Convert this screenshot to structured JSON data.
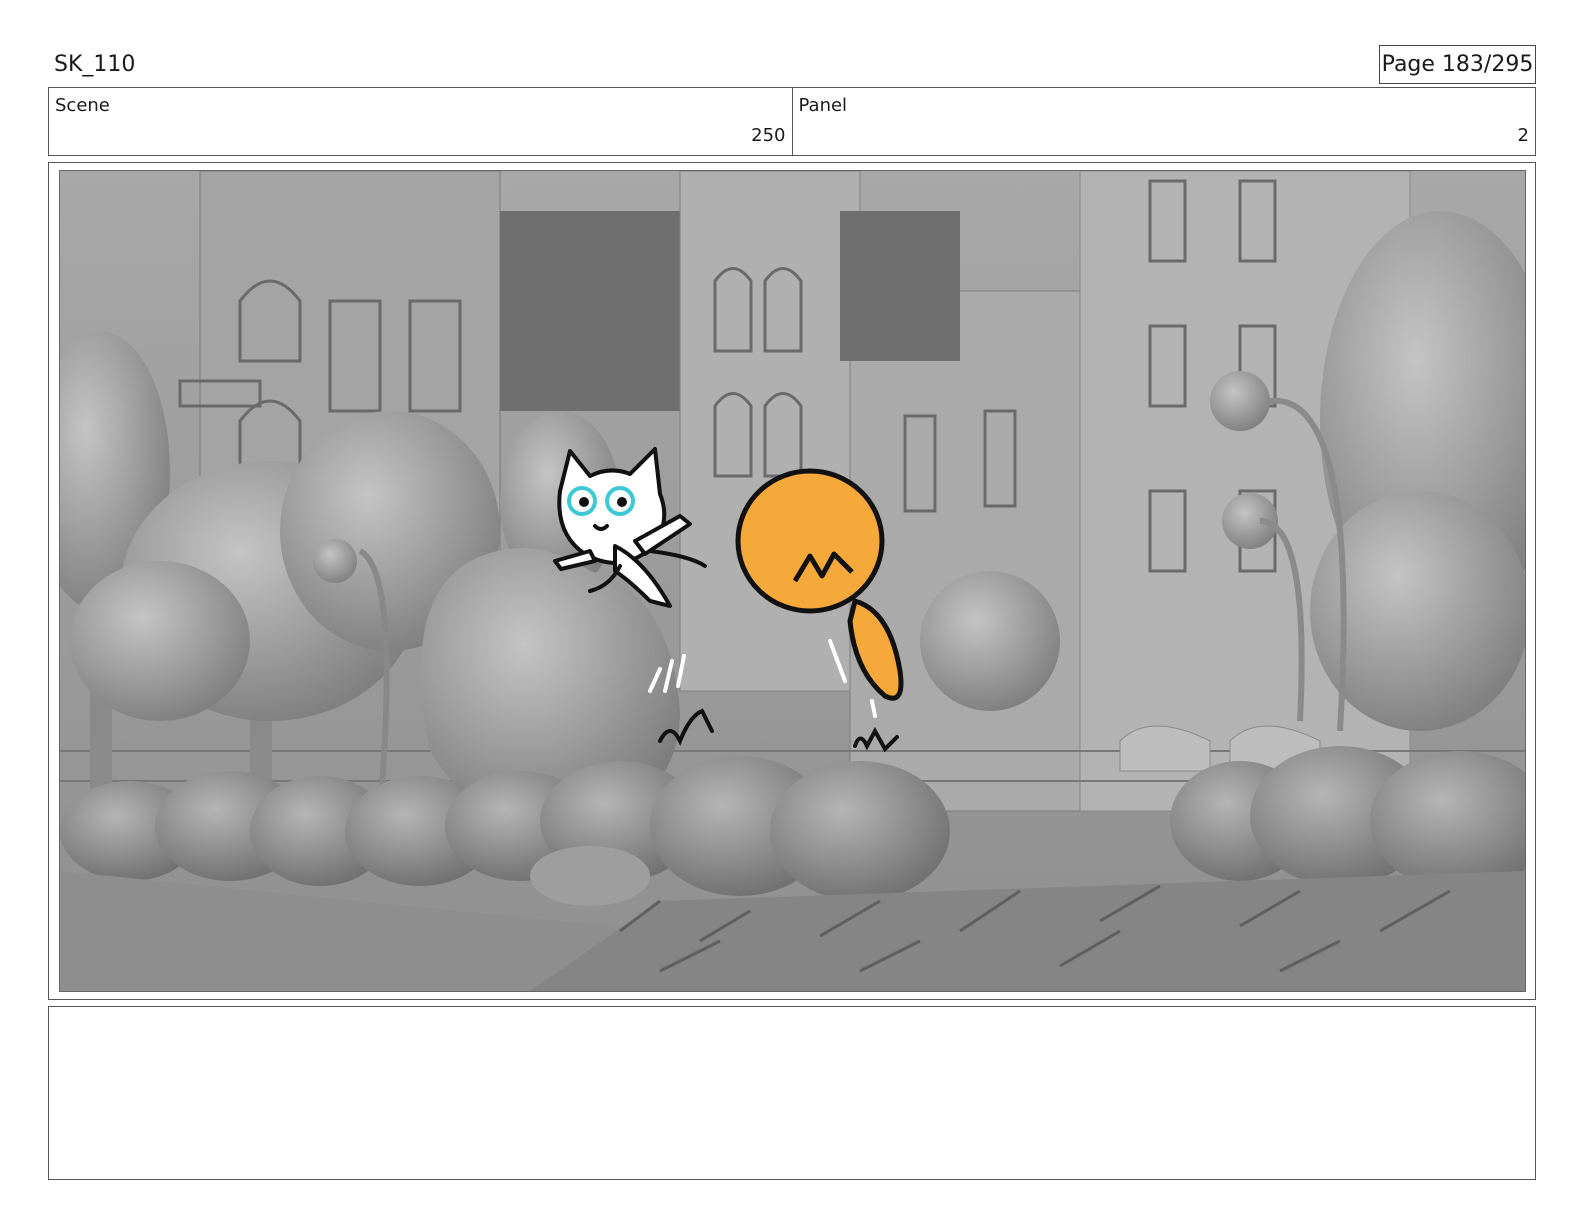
{
  "document": {
    "sequence_id": "SK_110",
    "page_label": "Page 183/295"
  },
  "header": {
    "scene_label": "Scene",
    "scene_value": "250",
    "panel_label": "Panel",
    "panel_value": "2"
  },
  "frame": {
    "description_icon": "storyboard-illustration",
    "colors": {
      "background_gray": "#9b9b9b",
      "character_orange": "#f5a93a",
      "accent_cyan": "#3cc9d6"
    }
  },
  "notes": {
    "text": ""
  }
}
